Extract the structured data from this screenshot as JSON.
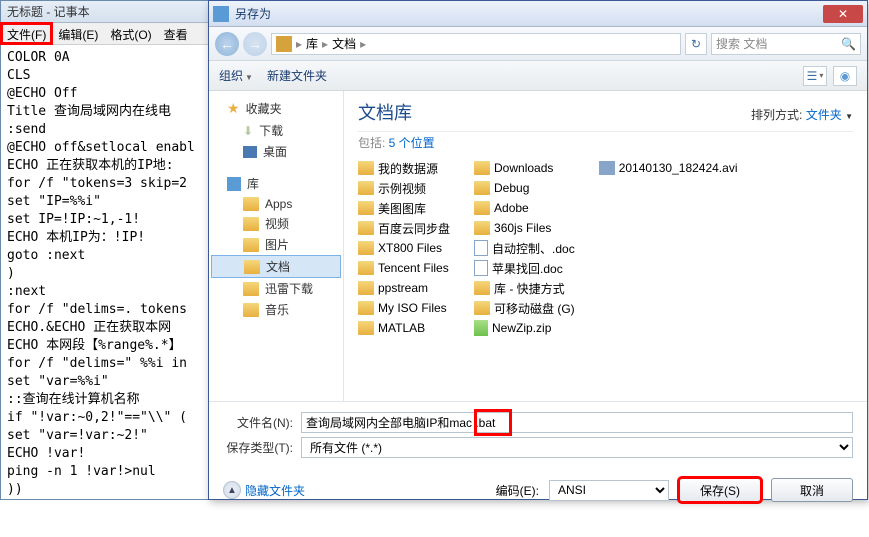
{
  "notepad": {
    "title": "无标题 - 记事本",
    "menu": {
      "file": "文件(F)",
      "edit": "编辑(E)",
      "format": "格式(O)",
      "view": "查看"
    },
    "body": "COLOR 0A\nCLS\n@ECHO Off\nTitle 查询局域网内在线电\n:send\n@ECHO off&setlocal enabl\nECHO 正在获取本机的IP地:\nfor /f \"tokens=3 skip=2\nset \"IP=%%i\"\nset IP=!IP:~1,-1!\nECHO 本机IP为：!IP!\ngoto :next\n)\n:next\nfor /f \"delims=. tokens\nECHO.&ECHO 正在获取本网\nECHO 本网段【%range%.*】\nfor /f \"delims=\" %%i in\nset \"var=%%i\"\n::查询在线计算机名称\nif \"!var:~0,2!\"==\"\\\\\" (\nset \"var=!var:~2!\"\nECHO !var!\nping -n 1 !var!>nul\n))\nECHO.\nECHO 正在获取本网段内的"
  },
  "dialog": {
    "title": "另存为",
    "crumb": {
      "root": "库",
      "current": "文档"
    },
    "search_placeholder": "搜索 文档",
    "toolbar": {
      "organize": "组织",
      "newfolder": "新建文件夹"
    },
    "sidebar": {
      "fav": "收藏夹",
      "downloads": "下载",
      "desktop": "桌面",
      "lib": "库",
      "apps": "Apps",
      "video": "视频",
      "pics": "图片",
      "docs": "文档",
      "xunlei": "迅雷下载",
      "music": "音乐"
    },
    "content": {
      "title": "文档库",
      "sub_prefix": "包括: ",
      "sub_link": "5 个位置",
      "sort_label": "排列方式: ",
      "sort_value": "文件夹",
      "col1": [
        "我的数据源",
        "示例视频",
        "美图图库",
        "百度云同步盘",
        "XT800 Files",
        "Tencent Files",
        "ppstream",
        "My ISO Files",
        "MATLAB"
      ],
      "col2": [
        {
          "n": "Downloads",
          "t": "folder"
        },
        {
          "n": "Debug",
          "t": "folder"
        },
        {
          "n": "Adobe",
          "t": "folder"
        },
        {
          "n": "360js Files",
          "t": "folder"
        },
        {
          "n": "自动控制、.doc",
          "t": "doc"
        },
        {
          "n": "苹果找回.doc",
          "t": "doc"
        },
        {
          "n": "库 - 快捷方式",
          "t": "folder"
        },
        {
          "n": "可移动磁盘 (G)",
          "t": "folder"
        },
        {
          "n": "NewZip.zip",
          "t": "zip"
        }
      ],
      "col3": [
        {
          "n": "20140130_182424.avi",
          "t": "avi"
        }
      ]
    },
    "form": {
      "filename_label": "文件名(N):",
      "filename_value": "查询局域网内全部电脑IP和mac .bat",
      "filetype_label": "保存类型(T):",
      "filetype_value": "所有文件 (*.*)"
    },
    "footer": {
      "hide": "隐藏文件夹",
      "enc_label": "编码(E):",
      "enc_value": "ANSI",
      "save": "保存(S)",
      "cancel": "取消"
    }
  }
}
